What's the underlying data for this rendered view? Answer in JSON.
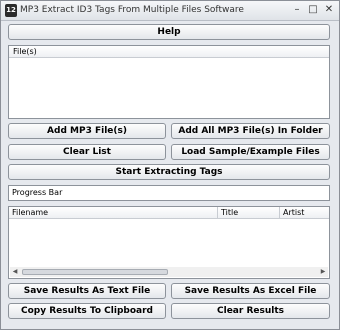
{
  "window": {
    "title": "MP3 Extract ID3 Tags From Multiple Files Software",
    "app_icon_text": "12",
    "minimize_glyph": "–",
    "maximize_glyph": "□",
    "close_glyph": "✕"
  },
  "toolbar": {
    "help_label": "Help"
  },
  "files_list": {
    "header": "File(s)"
  },
  "buttons": {
    "add_mp3": "Add MP3 File(s)",
    "add_all_folder": "Add All MP3 File(s) In Folder",
    "clear_list": "Clear List",
    "load_sample": "Load Sample/Example Files",
    "start_extracting": "Start Extracting Tags",
    "save_text": "Save Results As Text File",
    "save_excel": "Save Results As Excel File",
    "copy_clipboard": "Copy Results To Clipboard",
    "clear_results": "Clear Results"
  },
  "progress": {
    "label": "Progress Bar"
  },
  "results_table": {
    "columns": [
      "Filename",
      "Title",
      "Artist"
    ],
    "rows": []
  },
  "scrollbar": {
    "left_arrow": "◀",
    "right_arrow": "▶"
  }
}
